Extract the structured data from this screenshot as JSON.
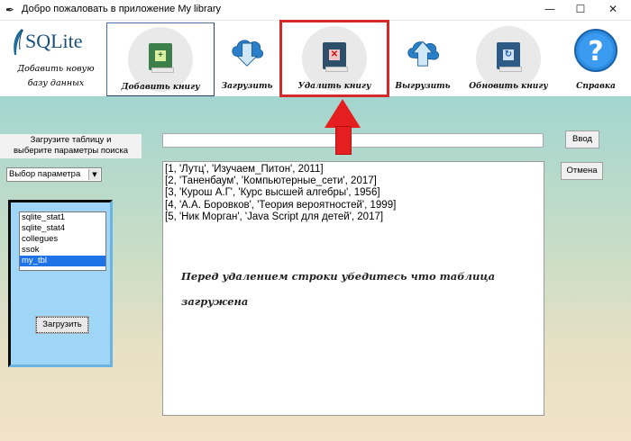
{
  "window": {
    "title": "Добро пожаловать в приложение My library",
    "minimize": "—",
    "maximize": "☐",
    "close": "✕"
  },
  "logo": {
    "text": "SQLite",
    "subtitle_line1": "Добавить новую",
    "subtitle_line2": "базу данных"
  },
  "toolbar": {
    "add_book": "Добавить книгу",
    "load": "Загрузить",
    "delete_book": "Удалить книгу",
    "upload": "Выгрузить",
    "refresh_book": "Обновить книгу",
    "help": "Справка"
  },
  "sidebar": {
    "prompt_line1": "Загрузите таблицу и",
    "prompt_line2": "выберите параметры поиска",
    "param_select": "Выбор параметра",
    "tables": [
      "sqlite_stat1",
      "sqlite_stat4",
      "collegues",
      "ssok",
      "my_tbl"
    ],
    "selected_table": "my_tbl",
    "load_button": "Загрузить"
  },
  "search": {
    "input_value": "",
    "enter_button": "Ввод",
    "cancel_button": "Отмена"
  },
  "output": {
    "rows": [
      "[1, 'Лутц', 'Изучаем_Питон', 2011]",
      "[2, 'Таненбаум', 'Компьютерные_сети', 2017]",
      "[3, 'Курош А.Г', 'Курс высшей алгебры', 1956]",
      "[4, 'А.А. Боровков', 'Теория вероятностей', 1999]",
      "[5, 'Ник Морган', 'Java Script для детей', 2017]"
    ],
    "note_line1": "Перед удалением строки убедитесь что таблица",
    "note_line2": "загружена"
  },
  "colors": {
    "highlight": "#d62a2a",
    "arrow": "#e51f1f",
    "selection": "#1e74e6",
    "panel": "#9fd6f7"
  },
  "icons": {
    "add_book": "green-book-plus-icon",
    "load": "cloud-download-icon",
    "delete_book": "red-book-x-icon",
    "upload": "cloud-upload-icon",
    "refresh_book": "blue-book-refresh-icon",
    "help": "question-mark-icon"
  }
}
